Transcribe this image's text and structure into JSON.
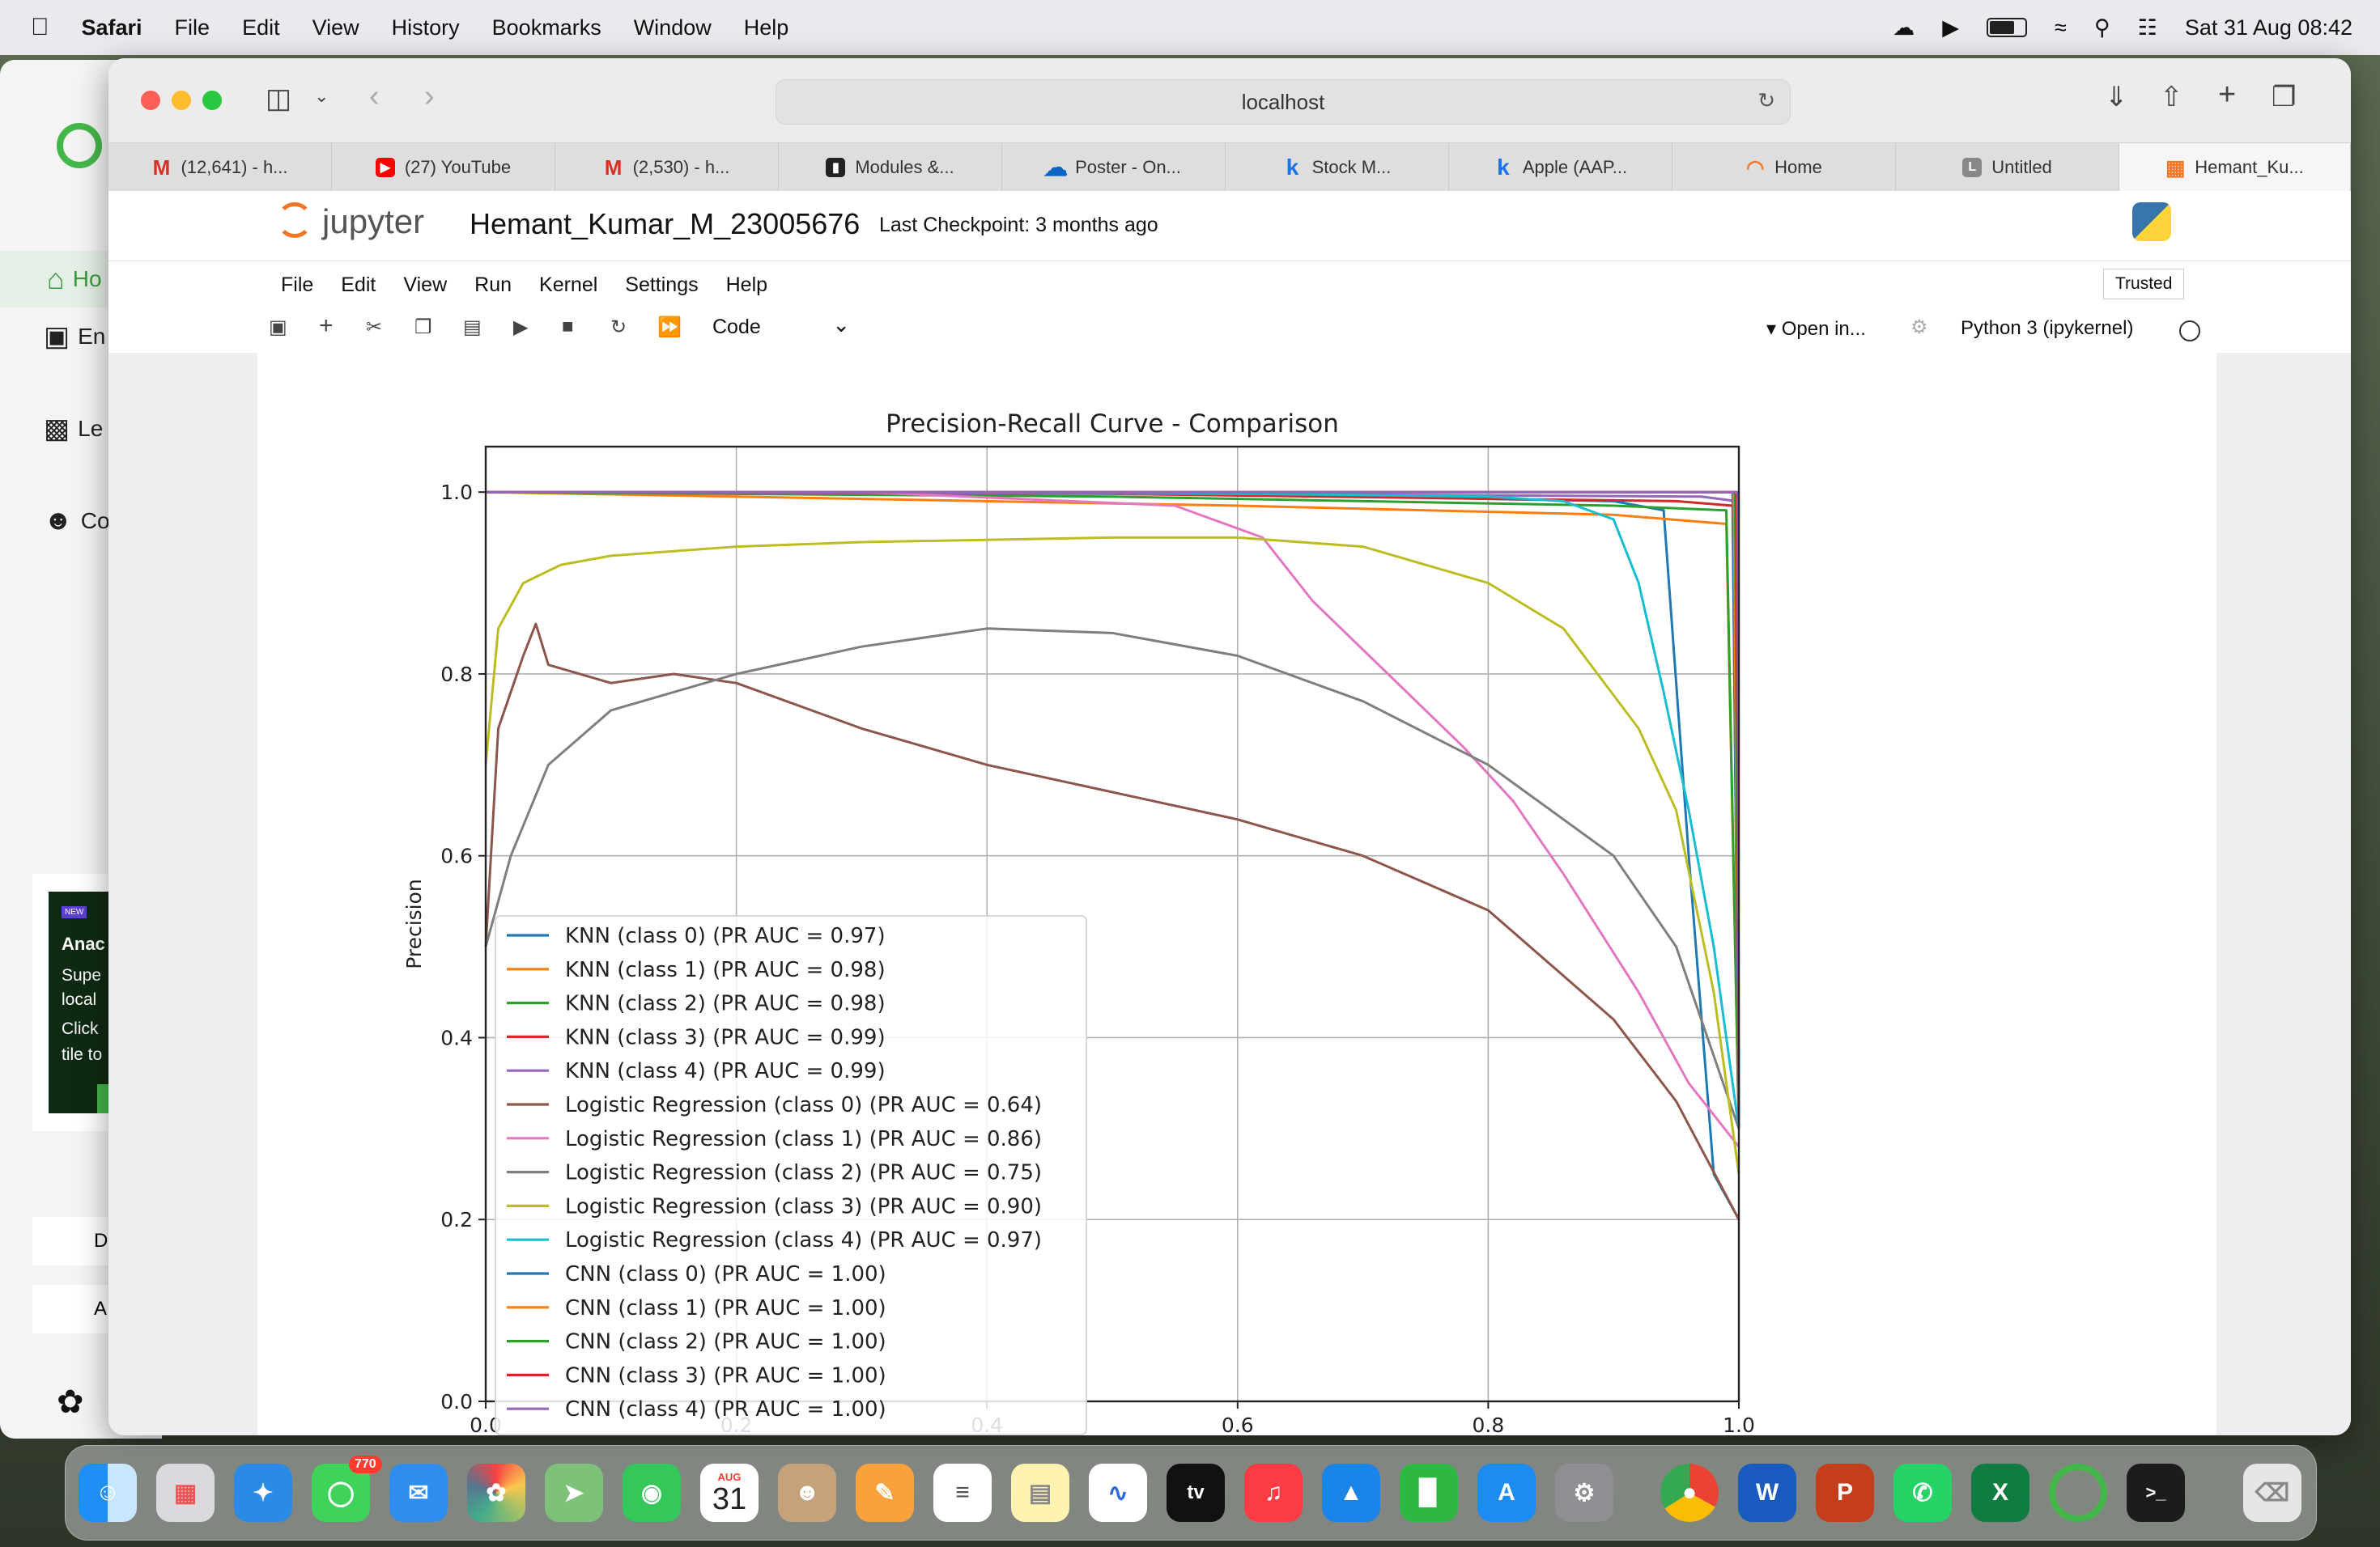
{
  "menubar": {
    "app": "Safari",
    "items": [
      "File",
      "Edit",
      "View",
      "History",
      "Bookmarks",
      "Window",
      "Help"
    ],
    "datetime": "Sat 31 Aug  08:42"
  },
  "sidebar": {
    "items": [
      "Ho",
      "En",
      "Le",
      "Co"
    ],
    "promo_badge": "NEW",
    "promo_title": "Anac",
    "promo_lines": [
      "Supe",
      "local",
      "Click",
      "tile to"
    ],
    "btn1": "D",
    "btn2": "A"
  },
  "browser": {
    "url": "localhost",
    "tabs": [
      {
        "label": "(12,641) - h...",
        "icon": "gmail-icon",
        "color": "#d93025"
      },
      {
        "label": "(27) YouTube",
        "icon": "youtube-icon",
        "color": "#ff0000"
      },
      {
        "label": "(2,530) - h...",
        "icon": "gmail-icon",
        "color": "#d93025"
      },
      {
        "label": "Modules &...",
        "icon": "modules-icon",
        "color": "#222222"
      },
      {
        "label": "Poster - On...",
        "icon": "onedrive-icon",
        "color": "#0a66c2"
      },
      {
        "label": "Stock M...",
        "icon": "k-icon",
        "color": "#1a73e8"
      },
      {
        "label": "Apple (AAP...",
        "icon": "k-icon",
        "color": "#1a73e8"
      },
      {
        "label": "Home",
        "icon": "jupyter-icon",
        "color": "#f37726"
      },
      {
        "label": "Untitled",
        "icon": "l-icon",
        "color": "#888888"
      },
      {
        "label": "Hemant_Ku...",
        "icon": "notebook-icon",
        "color": "#f37726"
      }
    ]
  },
  "jupyter": {
    "logo": "jupyter",
    "notebook": "Hemant_Kumar_M_23005676",
    "checkpoint": "Last Checkpoint: 3 months ago",
    "menu": [
      "File",
      "Edit",
      "View",
      "Run",
      "Kernel",
      "Settings",
      "Help"
    ],
    "trusted": "Trusted",
    "cell_type": "Code",
    "open_in": "Open in...",
    "kernel": "Python 3 (ipykernel)"
  },
  "chart_data": {
    "type": "line",
    "title": "Precision-Recall Curve - Comparison",
    "xlabel": "",
    "ylabel": "Precision",
    "xlim": [
      0,
      1
    ],
    "ylim": [
      0,
      1.05
    ],
    "xticks": [
      "0.0",
      "0.2",
      "0.4",
      "0.6",
      "0.8",
      "1.0"
    ],
    "yticks": [
      "0.0",
      "0.2",
      "0.4",
      "0.6",
      "0.8",
      "1.0"
    ],
    "grid": true,
    "legend_position": "lower-left",
    "series": [
      {
        "name": "KNN (class 0) (PR AUC = 0.97)",
        "color": "#1f77b4",
        "points": [
          [
            0,
            1
          ],
          [
            0.5,
            1
          ],
          [
            0.9,
            0.99
          ],
          [
            0.94,
            0.98
          ],
          [
            0.96,
            0.6
          ],
          [
            0.98,
            0.25
          ],
          [
            1,
            0.2
          ]
        ]
      },
      {
        "name": "KNN (class 1) (PR AUC = 0.98)",
        "color": "#ff7f0e",
        "points": [
          [
            0,
            1
          ],
          [
            0.2,
            0.995
          ],
          [
            0.6,
            0.985
          ],
          [
            0.9,
            0.975
          ],
          [
            0.99,
            0.965
          ],
          [
            1,
            0.3
          ]
        ]
      },
      {
        "name": "KNN (class 2) (PR AUC = 0.98)",
        "color": "#2ca02c",
        "points": [
          [
            0,
            1
          ],
          [
            0.5,
            0.995
          ],
          [
            0.9,
            0.985
          ],
          [
            0.99,
            0.98
          ],
          [
            1,
            0.3
          ]
        ]
      },
      {
        "name": "KNN (class 3) (PR AUC = 0.99)",
        "color": "#d62728",
        "points": [
          [
            0,
            1
          ],
          [
            0.5,
            0.998
          ],
          [
            0.95,
            0.99
          ],
          [
            0.995,
            0.985
          ],
          [
            1,
            0.3
          ]
        ]
      },
      {
        "name": "KNN (class 4) (PR AUC = 0.99)",
        "color": "#9467bd",
        "points": [
          [
            0,
            1
          ],
          [
            0.6,
            0.998
          ],
          [
            0.97,
            0.995
          ],
          [
            0.998,
            0.99
          ],
          [
            1,
            0.3
          ]
        ]
      },
      {
        "name": "Logistic Regression (class 0) (PR AUC = 0.64)",
        "color": "#8c564b",
        "points": [
          [
            0,
            0.5
          ],
          [
            0.01,
            0.74
          ],
          [
            0.03,
            0.82
          ],
          [
            0.04,
            0.855
          ],
          [
            0.05,
            0.81
          ],
          [
            0.1,
            0.79
          ],
          [
            0.15,
            0.8
          ],
          [
            0.2,
            0.79
          ],
          [
            0.3,
            0.74
          ],
          [
            0.4,
            0.7
          ],
          [
            0.5,
            0.67
          ],
          [
            0.6,
            0.64
          ],
          [
            0.7,
            0.6
          ],
          [
            0.8,
            0.54
          ],
          [
            0.9,
            0.42
          ],
          [
            0.95,
            0.33
          ],
          [
            1,
            0.2
          ]
        ]
      },
      {
        "name": "Logistic Regression (class 1) (PR AUC = 0.86)",
        "color": "#e377c2",
        "points": [
          [
            0,
            1
          ],
          [
            0.3,
            1
          ],
          [
            0.55,
            0.985
          ],
          [
            0.62,
            0.95
          ],
          [
            0.66,
            0.88
          ],
          [
            0.72,
            0.8
          ],
          [
            0.78,
            0.72
          ],
          [
            0.82,
            0.66
          ],
          [
            0.86,
            0.58
          ],
          [
            0.92,
            0.45
          ],
          [
            0.96,
            0.35
          ],
          [
            1,
            0.28
          ]
        ]
      },
      {
        "name": "Logistic Regression (class 2) (PR AUC = 0.75)",
        "color": "#7f7f7f",
        "points": [
          [
            0,
            0.5
          ],
          [
            0.02,
            0.6
          ],
          [
            0.05,
            0.7
          ],
          [
            0.1,
            0.76
          ],
          [
            0.2,
            0.8
          ],
          [
            0.3,
            0.83
          ],
          [
            0.4,
            0.85
          ],
          [
            0.5,
            0.845
          ],
          [
            0.6,
            0.82
          ],
          [
            0.7,
            0.77
          ],
          [
            0.8,
            0.7
          ],
          [
            0.9,
            0.6
          ],
          [
            0.95,
            0.5
          ],
          [
            0.98,
            0.38
          ],
          [
            1,
            0.3
          ]
        ]
      },
      {
        "name": "Logistic Regression (class 3) (PR AUC = 0.90)",
        "color": "#bcbd22",
        "points": [
          [
            0,
            0.7
          ],
          [
            0.01,
            0.85
          ],
          [
            0.03,
            0.9
          ],
          [
            0.06,
            0.92
          ],
          [
            0.1,
            0.93
          ],
          [
            0.2,
            0.94
          ],
          [
            0.3,
            0.945
          ],
          [
            0.5,
            0.95
          ],
          [
            0.6,
            0.95
          ],
          [
            0.7,
            0.94
          ],
          [
            0.8,
            0.9
          ],
          [
            0.86,
            0.85
          ],
          [
            0.92,
            0.74
          ],
          [
            0.95,
            0.65
          ],
          [
            0.98,
            0.45
          ],
          [
            1,
            0.25
          ]
        ]
      },
      {
        "name": "Logistic Regression (class 4) (PR AUC = 0.97)",
        "color": "#17becf",
        "points": [
          [
            0,
            1
          ],
          [
            0.5,
            1
          ],
          [
            0.8,
            0.995
          ],
          [
            0.86,
            0.99
          ],
          [
            0.9,
            0.97
          ],
          [
            0.92,
            0.9
          ],
          [
            0.94,
            0.78
          ],
          [
            0.96,
            0.65
          ],
          [
            0.98,
            0.5
          ],
          [
            1,
            0.3
          ]
        ]
      },
      {
        "name": "CNN (class 0) (PR AUC = 1.00)",
        "color": "#1f77b4",
        "points": [
          [
            0,
            1
          ],
          [
            0.995,
            1
          ],
          [
            1,
            0.3
          ]
        ]
      },
      {
        "name": "CNN (class 1) (PR AUC = 1.00)",
        "color": "#ff7f0e",
        "points": [
          [
            0,
            1
          ],
          [
            0.996,
            1
          ],
          [
            1,
            0.3
          ]
        ]
      },
      {
        "name": "CNN (class 2) (PR AUC = 1.00)",
        "color": "#2ca02c",
        "points": [
          [
            0,
            1
          ],
          [
            0.997,
            1
          ],
          [
            1,
            0.3
          ]
        ]
      },
      {
        "name": "CNN (class 3) (PR AUC = 1.00)",
        "color": "#d62728",
        "points": [
          [
            0,
            1
          ],
          [
            0.998,
            1
          ],
          [
            1,
            0.3
          ]
        ]
      },
      {
        "name": "CNN (class 4) (PR AUC = 1.00)",
        "color": "#9467bd",
        "points": [
          [
            0,
            1
          ],
          [
            0.999,
            1
          ],
          [
            1,
            0.3
          ]
        ]
      }
    ]
  },
  "dock": {
    "messages_badge": "770",
    "calendar_month": "AUG",
    "calendar_day": "31"
  }
}
